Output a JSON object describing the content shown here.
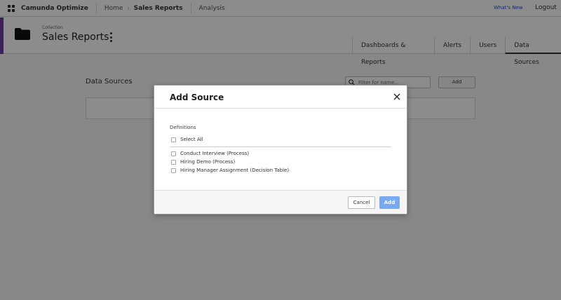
{
  "topbar": {
    "brand": "Camunda Optimize",
    "crumbs": {
      "home": "Home",
      "current": "Sales Reports",
      "analysis": "Analysis"
    },
    "whats_new": "What's New",
    "logout": "Logout"
  },
  "header": {
    "label": "Collection",
    "title": "Sales Reports",
    "tabs": [
      "Dashboards & Reports",
      "Alerts",
      "Users",
      "Data Sources"
    ],
    "active_tab": "Data Sources"
  },
  "content": {
    "title": "Data Sources",
    "search_placeholder": "Filter for name...",
    "add_label": "Add"
  },
  "modal": {
    "title": "Add Source",
    "section_label": "Definitions",
    "select_all": "Select All",
    "definitions": [
      "Conduct Interview (Process)",
      "Hiring Demo (Process)",
      "Hiring Manager Assignment (Decision Table)"
    ],
    "cancel_label": "Cancel",
    "add_label": "Add"
  },
  "colors": {
    "accent": "#6b3fa0",
    "primary_button": "#77aaf0",
    "link": "#1d4ec7"
  },
  "icons": {
    "logo": "grid-icon",
    "folder": "folder-icon",
    "menu": "kebab-icon",
    "search": "search-icon",
    "close": "close-icon"
  }
}
